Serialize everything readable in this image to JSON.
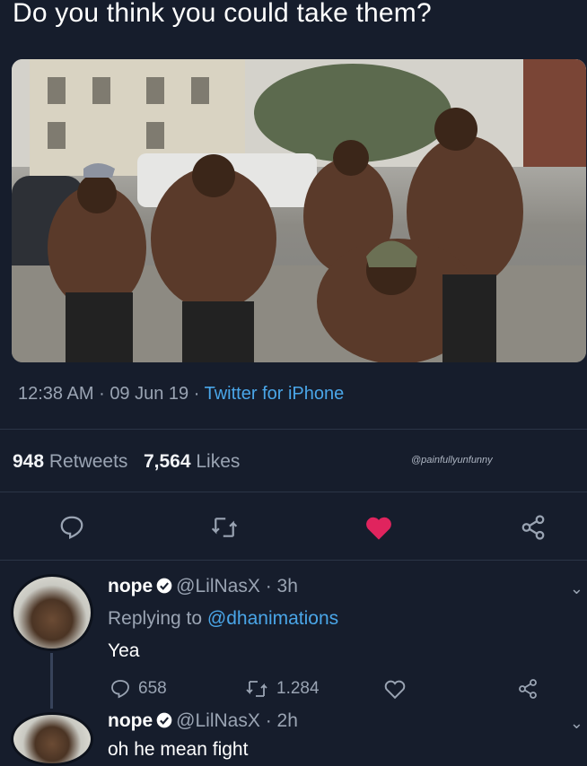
{
  "caption": "Do you think you could take them?",
  "tweet": {
    "time": "12:38 AM",
    "date": "09 Jun 19",
    "source": "Twitter for iPhone",
    "retweets_count": "948",
    "retweets_label": "Retweets",
    "likes_count": "7,564",
    "likes_label": "Likes",
    "watermark": "@painfullyunfunny",
    "like_color": "#e0245e"
  },
  "replies": [
    {
      "name": "nope",
      "handle": "@LilNasX",
      "age": "3h",
      "replying_prefix": "Replying to",
      "replying_to": "@dhanimations",
      "text": "Yea",
      "reply_count": "658",
      "retweet_count": "1.284"
    },
    {
      "name": "nope",
      "handle": "@LilNasX",
      "age": "2h",
      "text": "oh he mean fight"
    }
  ],
  "sep": "·",
  "icons": [
    "reply-icon",
    "retweet-icon",
    "heart-icon",
    "share-icon",
    "verified-icon",
    "chevron-down-icon"
  ]
}
